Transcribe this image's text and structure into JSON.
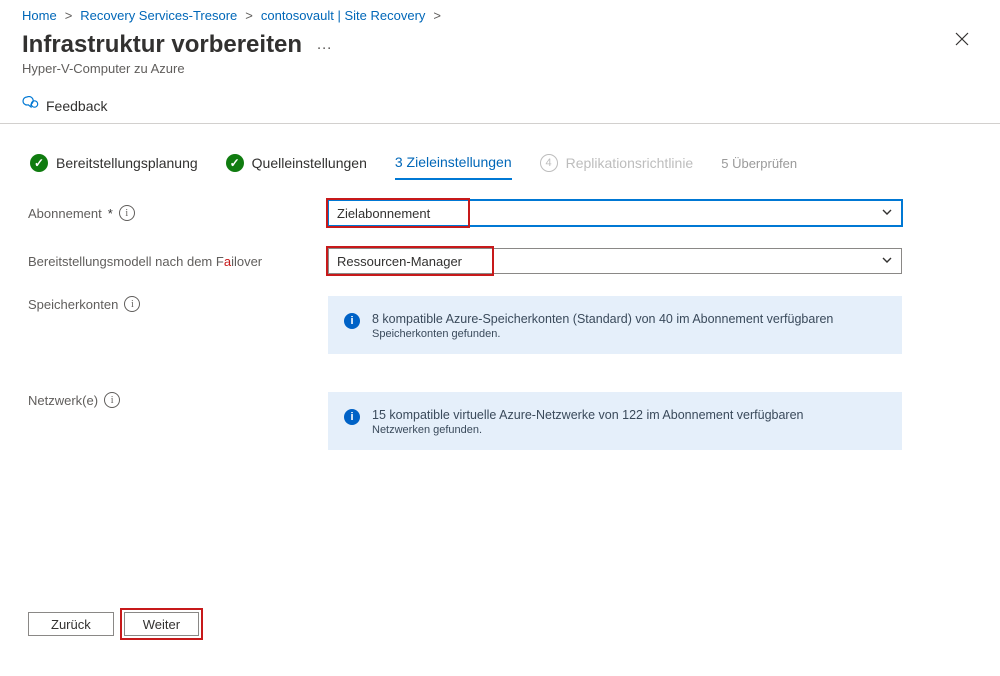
{
  "breadcrumb": {
    "home": "Home",
    "recovery_services": "Recovery Services-Tresore",
    "vault": "contosovault | Site Recovery"
  },
  "header": {
    "title": "Infrastruktur vorbereiten",
    "subtitle": "Hyper-V-Computer zu Azure",
    "more_aria": "Weitere Aktionen",
    "close_aria": "Schließen"
  },
  "commands": {
    "feedback": "Feedback"
  },
  "steps": {
    "s1": "Bereitstellungsplanung",
    "s2": "Quelleinstellungen",
    "s3": "3 Zieleinstellungen",
    "s4": "Replikationsrichtlinie",
    "s4_num": "4",
    "s5": "5 Überprüfen"
  },
  "form": {
    "subscription": {
      "label": "Abonnement",
      "required_marker": "*",
      "value": "Zielabonnement"
    },
    "deployment_model": {
      "label_pre": "Bereitstellungsmodell nach dem F",
      "label_post": "ilover",
      "value": "Ressourcen-Manager"
    },
    "storage": {
      "label": "Speicherkonten",
      "callout": "8 kompatible Azure-Speicherkonten (Standard) von 40 im Abonnement verfügbaren",
      "callout_sub": "Speicherkonten gefunden."
    },
    "networks": {
      "label": "Netzwerk(e)",
      "callout": "15 kompatible virtuelle Azure-Netzwerke von 122 im Abonnement verfügbaren",
      "callout_sub": "Netzwerken gefunden."
    }
  },
  "footer": {
    "back": "Zurück",
    "next": "Weiter"
  }
}
